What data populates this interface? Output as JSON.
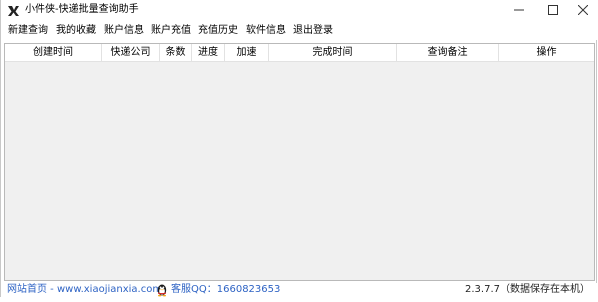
{
  "window": {
    "title": "小件侠-快递批量查询助手",
    "buttons": {
      "minimize_icon": "minimize-icon",
      "maximize_icon": "maximize-icon",
      "close_icon": "close-icon"
    }
  },
  "menu": {
    "items": [
      "新建查询",
      "我的收藏",
      "账户信息",
      "账户充值",
      "充值历史",
      "软件信息",
      "退出登录"
    ]
  },
  "table": {
    "columns": [
      "创建时间",
      "快递公司",
      "条数",
      "进度",
      "加速",
      "完成时间",
      "查询备注",
      "操作"
    ],
    "rows": []
  },
  "status": {
    "site_link": "网站首页 - www.xiaojianxia.com",
    "qq_label": "客服QQ：1660823653",
    "version": "2.3.7.7（数据保存在本机）"
  },
  "colors": {
    "link": "#2e63c4",
    "table_bg": "#f0f0f0",
    "border": "#b9b9b9"
  }
}
